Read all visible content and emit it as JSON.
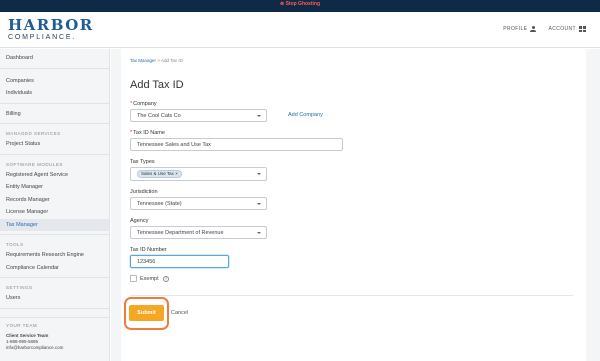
{
  "topbar": {
    "stop_ghosting": "⊗ Stop Ghosting"
  },
  "header": {
    "logo_top": "HARBOR",
    "logo_bottom": "COMPLIANCE.",
    "profile": "PROFILE",
    "account": "ACCOUNT"
  },
  "sidebar": {
    "dashboard": "Dashboard",
    "companies": "Companies",
    "individuals": "Individuals",
    "billing": "Billing",
    "managed_heading": "MANAGED SERVICES",
    "project_status": "Project Status",
    "modules_heading": "SOFTWARE MODULES",
    "registered_agent": "Registered Agent Service",
    "entity_manager": "Entity Manager",
    "records_manager": "Records Manager",
    "license_manager": "License Manager",
    "tax_manager": "Tax Manager",
    "tools_heading": "TOOLS",
    "requirements": "Requirements Research Engine",
    "calendar": "Compliance Calendar",
    "settings_heading": "SETTINGS",
    "users": "Users",
    "team_heading": "YOUR TEAM",
    "team_name": "Client Service Team",
    "team_phone": "1-888-995-5895",
    "team_email": "info@harborcompliance.com"
  },
  "breadcrumb": {
    "parent": "Tax Manager",
    "separator": ">",
    "current": "Add Tax ID"
  },
  "page_title": "Add Tax ID",
  "form": {
    "company_label": "Company",
    "company_value": "The Cool Cats Co",
    "add_company": "Add Company",
    "tax_id_name_label": "Tax ID Name",
    "tax_id_name_value": "Tennessee Sales and Use Tax",
    "tax_types_label": "Tax Types",
    "tax_type_tag": "Sales & Use Tax",
    "tag_remove": "×",
    "jurisdiction_label": "Jurisdiction",
    "jurisdiction_value": "Tennessee (State)",
    "agency_label": "Agency",
    "agency_value": "Tennessee Department of Revenue",
    "tax_id_number_label": "Tax ID Number",
    "tax_id_number_value": "123456",
    "exempt_label": "Exempt",
    "help_glyph": "?",
    "submit": "Submit",
    "cancel": "Cancel"
  },
  "colors": {
    "header_bar": "#0f2a45",
    "brand_blue": "#1f5c96",
    "link_blue": "#2a6cb0",
    "submit_orange": "#f5a623",
    "highlight_orange": "#f07b3f"
  },
  "icons": [
    "user-icon",
    "grid-icon",
    "chevron-down-icon",
    "help-icon",
    "checkbox-icon"
  ]
}
